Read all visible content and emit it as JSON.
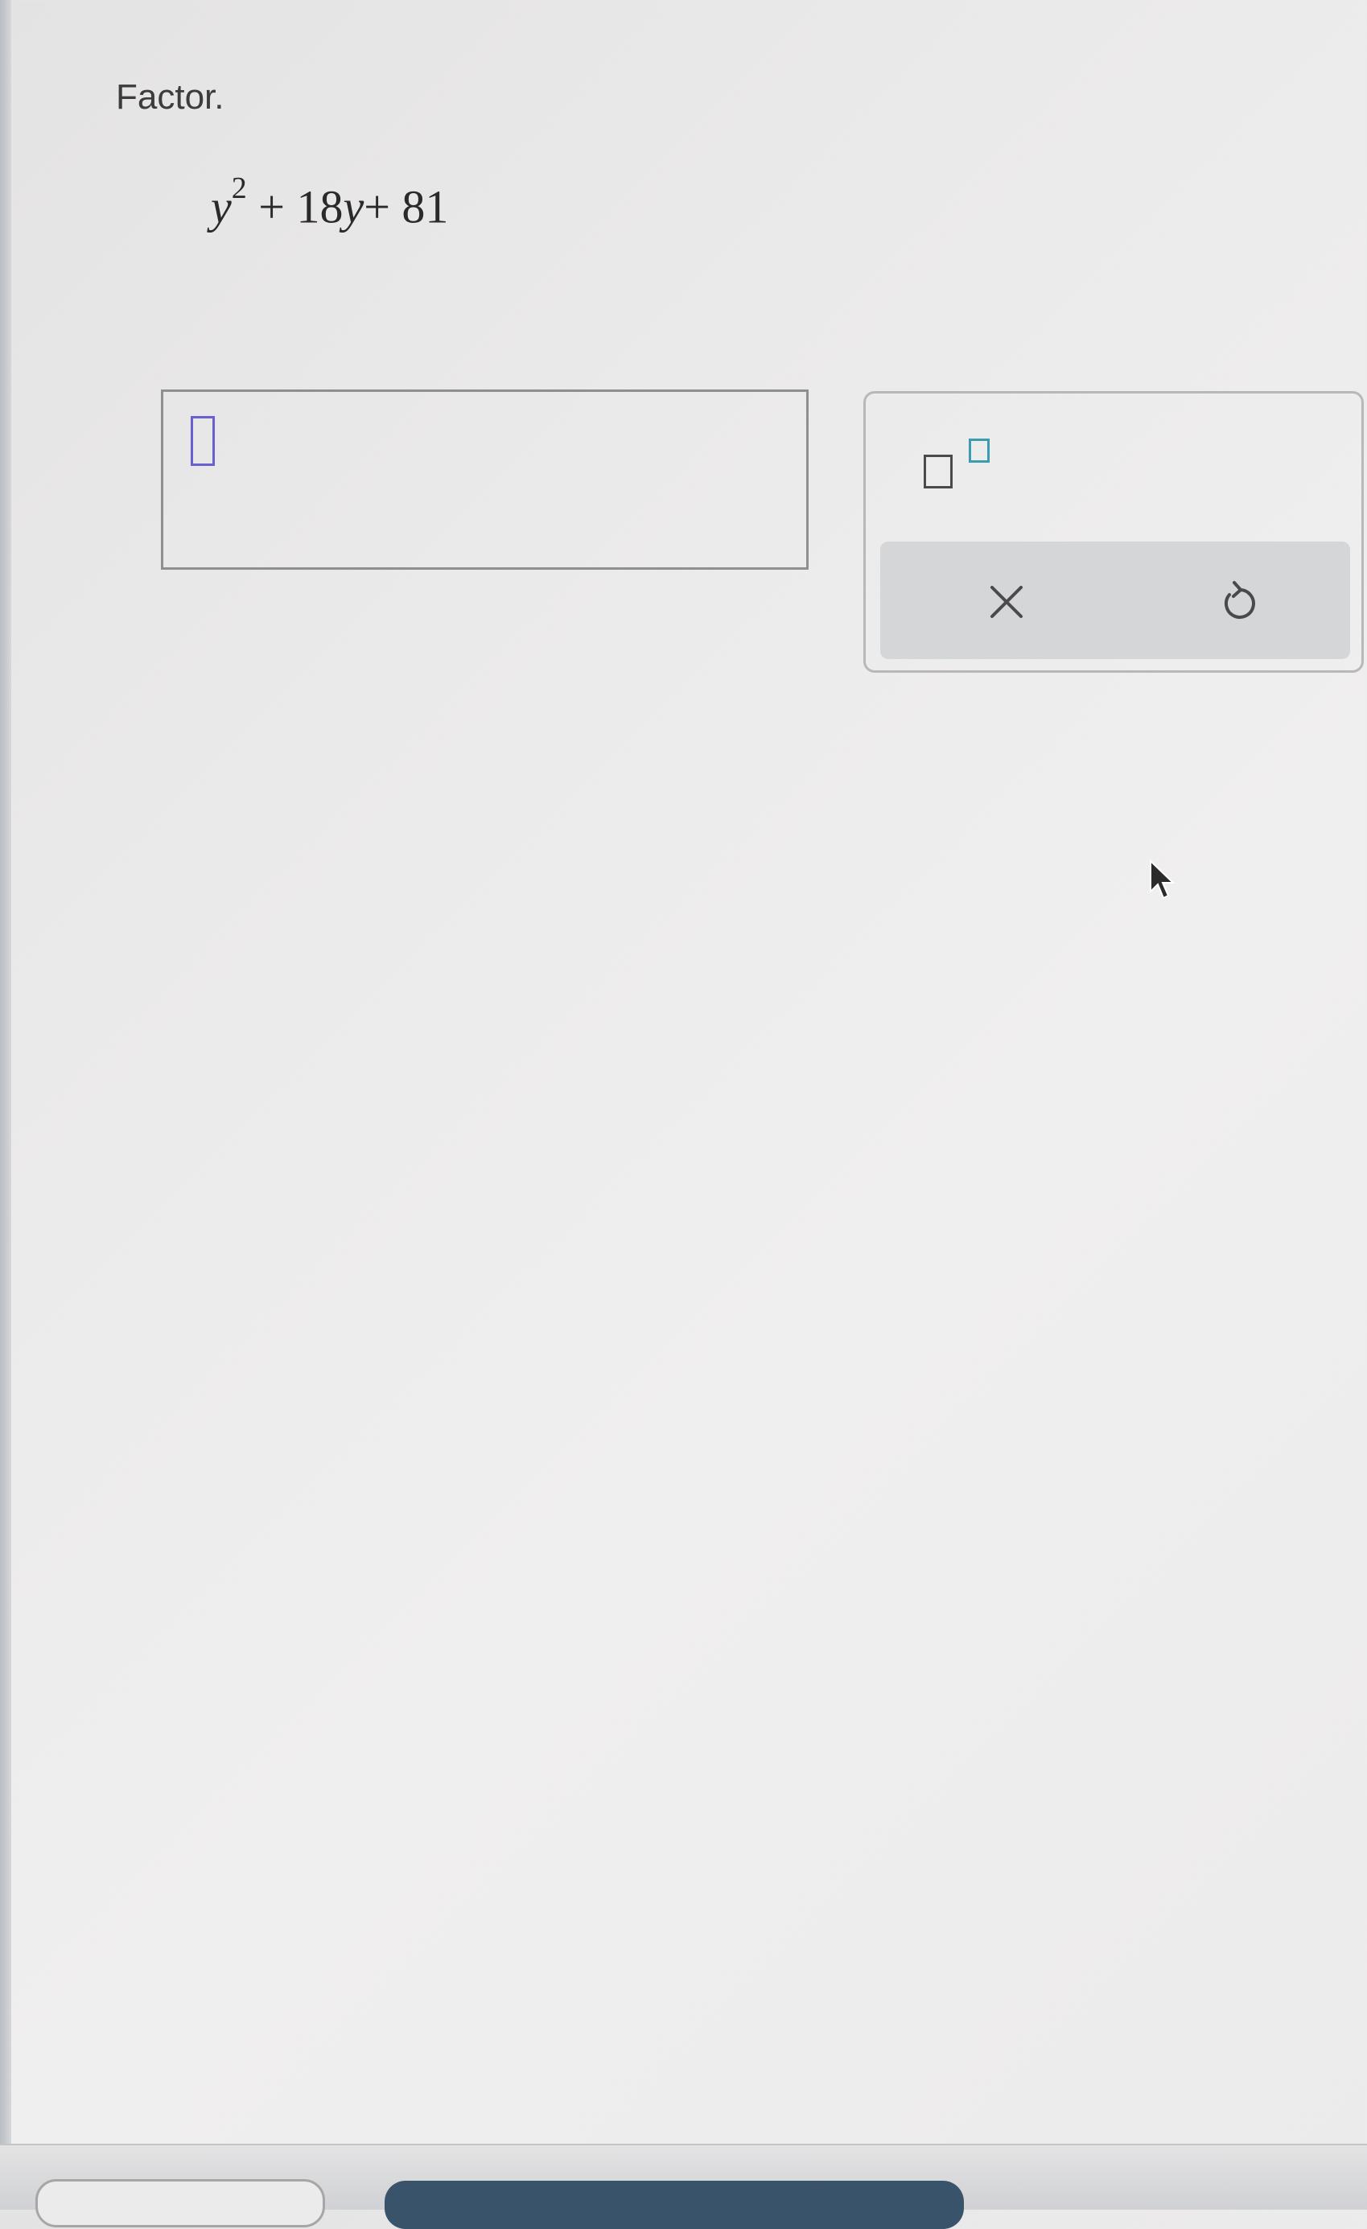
{
  "prompt": "Factor.",
  "expression": {
    "base_var": "y",
    "exponent": "2",
    "rest_before_var": "+ 18",
    "var2": "y",
    "rest_after": "+ 81"
  },
  "answer": {
    "value": ""
  },
  "palette": {
    "exponent_tool": "exponent-template-icon",
    "clear_icon": "close-icon",
    "undo_icon": "undo-icon"
  },
  "colors": {
    "cursor_box": "#6a5fd1",
    "exponent_sup": "#3b9bb0",
    "action_bar": "#d5d6d8",
    "bottom_button": "#39536b"
  }
}
